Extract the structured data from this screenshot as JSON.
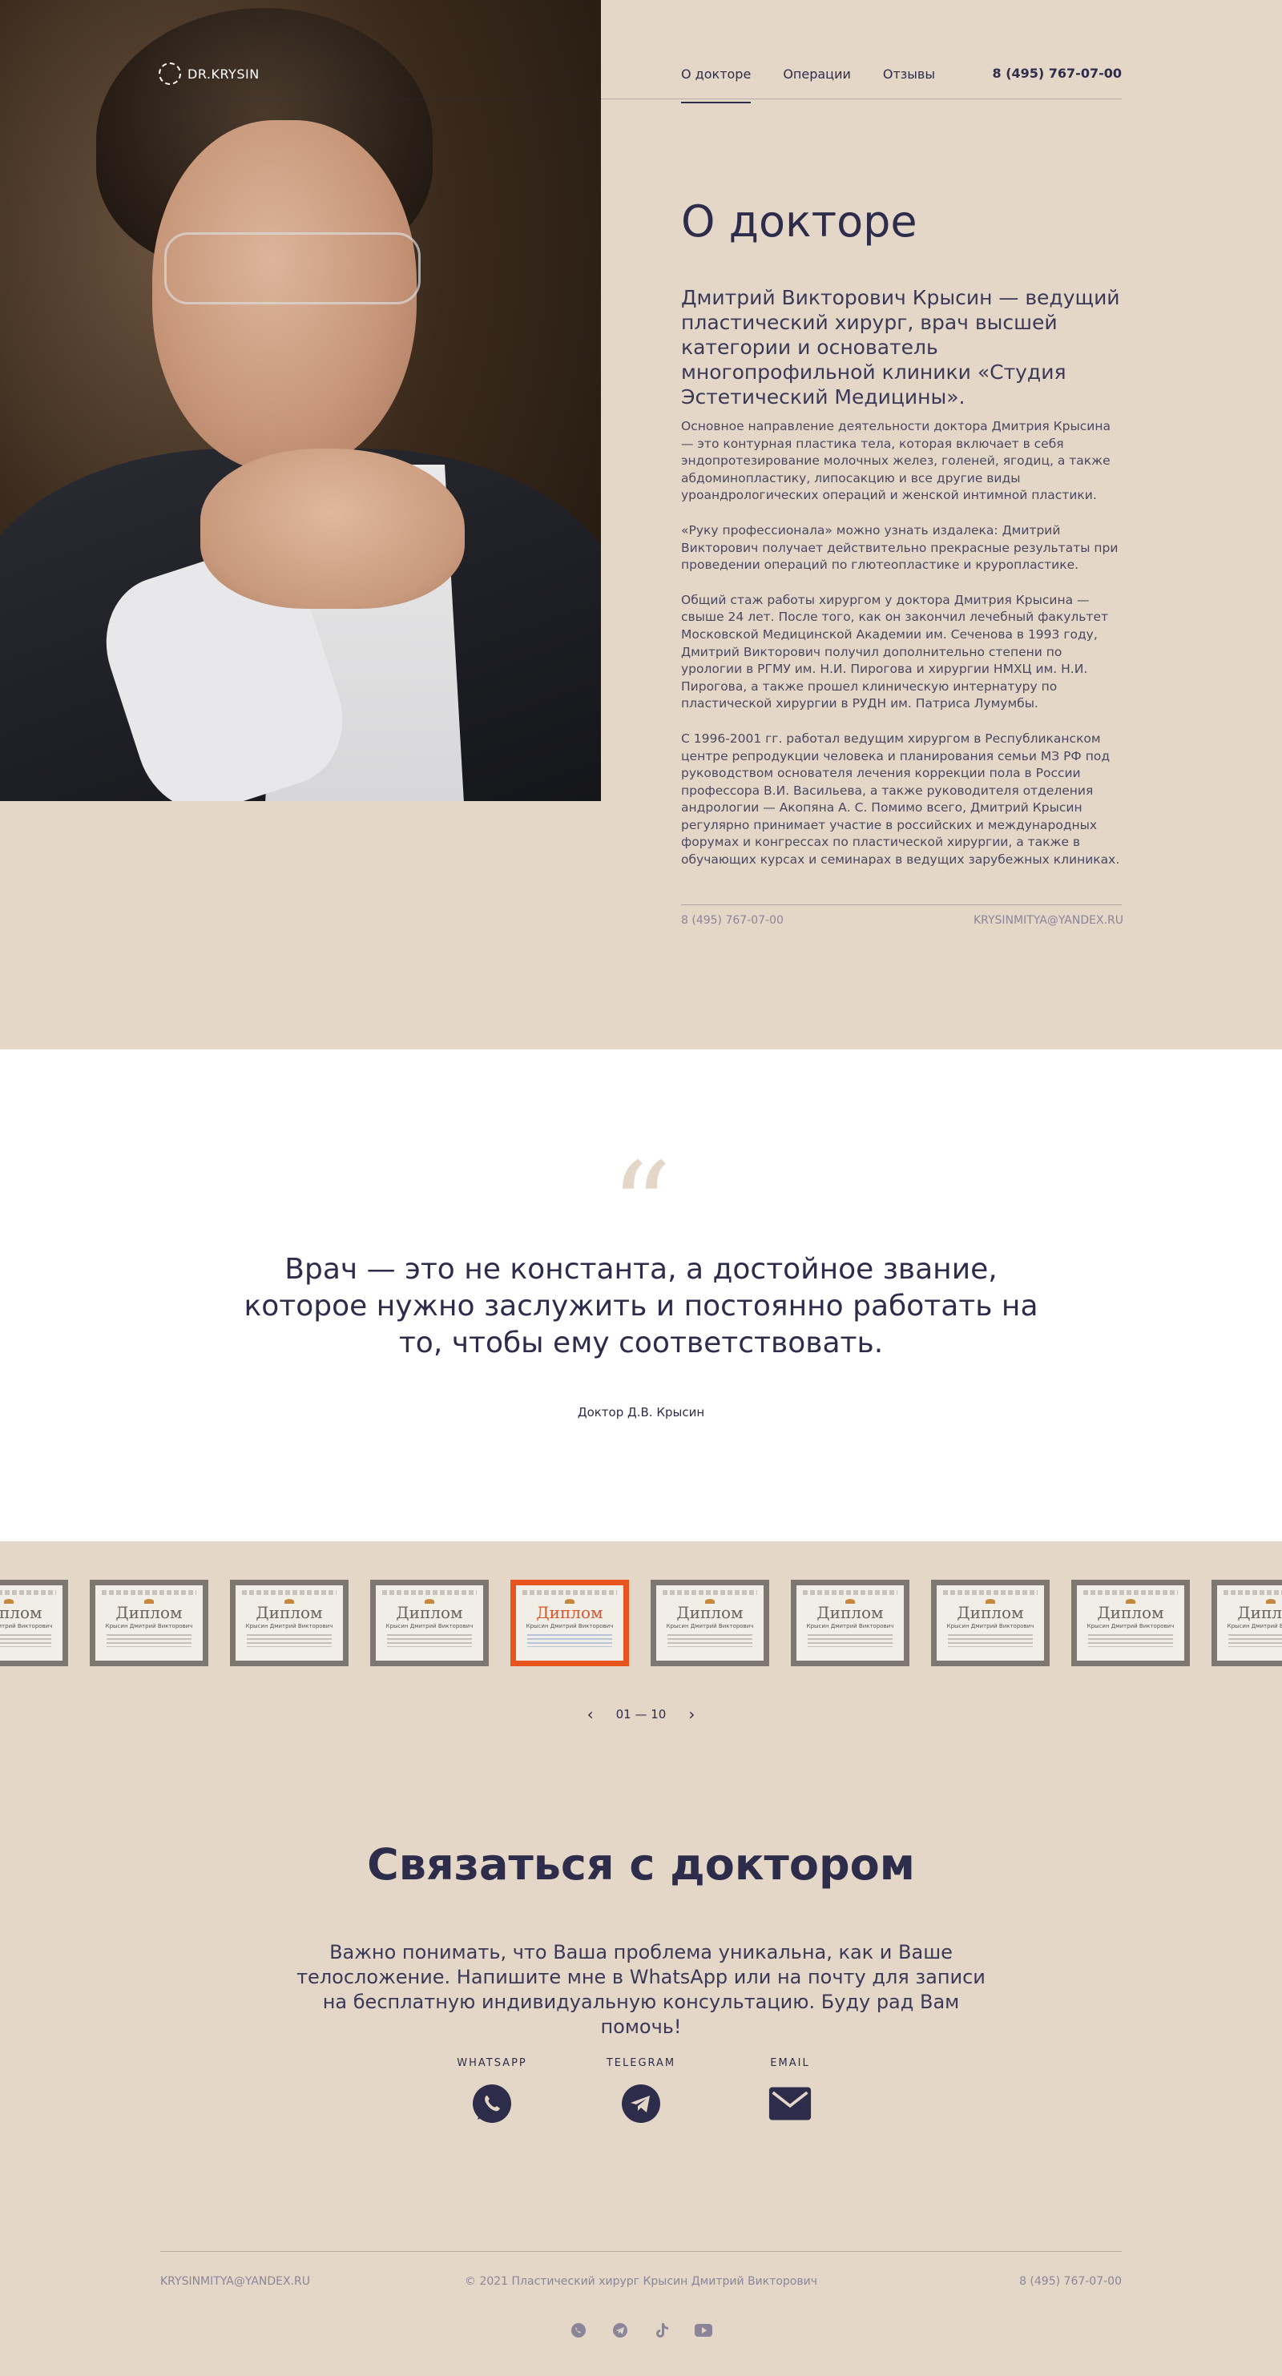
{
  "header": {
    "logo_text": "DR.KRYSIN",
    "nav": [
      {
        "label": "О докторе"
      },
      {
        "label": "Операции"
      },
      {
        "label": "Отзывы"
      }
    ],
    "phone": "8 (495) 767-07-00"
  },
  "about": {
    "title": "О докторе",
    "lead": "Дмитрий Викторович Крысин — ведущий пластический хирург, врач высшей категории и основатель многопрофильной клиники «Студия Эстетический Медицины».",
    "paragraphs": [
      "Основное направление деятельности доктора Дмитрия Крысина — это контурная пластика тела, которая включает в себя эндопротезирование молочных желез, голеней, ягодиц, а также абдоминопластику, липосакцию и все другие виды уроандрологических операций и женской интимной пластики.",
      "«Руку профессионала» можно узнать издалека: Дмитрий Викторович получает действительно прекрасные результаты при проведении операций по глютеопластике и круропластике.",
      "Общий стаж работы хирургом у доктора Дмитрия Крысина — свыше 24 лет. После того, как он закончил лечебный факультет Московской Медицинской Академии им. Сеченова в 1993 году, Дмитрий Викторович получил дополнительно степени по урологии в РГМУ им. Н.И. Пирогова и хирургии НМХЦ им. Н.И. Пирогова, а также прошел клиническую интернатуру по пластической хирургии в РУДН им. Патриса Лумумбы.",
      "С 1996-2001 гг. работал ведущим хирургом в Республиканском центре репродукции человека и планирования семьи МЗ РФ под руководством основателя лечения коррекции пола в России профессора В.И. Васильева, а также руководителя отделения андрологии — Акопяна А. С. Помимо всего, Дмитрий Крысин регулярно принимает участие в российских и международных форумах и конгрессах по пластической хирургии, а также в обучающих курсах и семинарах в ведущих зарубежных клиниках."
    ],
    "phone": "8 (495) 767-07-00",
    "email": "KRYSINMITYA@YANDEX.RU"
  },
  "quote": {
    "mark": "“",
    "text": "Врач — это не константа, а достойное звание, которое нужно заслужить и постоянно работать на то, чтобы ему соответствовать.",
    "author": "Доктор Д.В. Крысин"
  },
  "diplomas": {
    "title_word": "Диплом",
    "name": "Крысин Дмитрий Викторович",
    "active_index": 4,
    "pager": "01 — 10",
    "prev_icon": "chevron-left-icon",
    "next_icon": "chevron-right-icon"
  },
  "contact": {
    "title": "Связаться с доктором",
    "text": "Важно понимать, что Ваша проблема уникальна, как и Ваше телосложение. Напишите мне в WhatsApp или на почту для записи на бесплатную индивидуальную консультацию. Буду рад Вам помочь!",
    "channels": [
      {
        "label": "WHATSAPP",
        "icon": "whatsapp-icon"
      },
      {
        "label": "TELEGRAM",
        "icon": "telegram-icon"
      },
      {
        "label": "EMAIL",
        "icon": "mail-icon"
      }
    ]
  },
  "footer": {
    "email": "KRYSINMITYA@YANDEX.RU",
    "copyright": "© 2021 Пластический хирург Крысин Дмитрий Викторович",
    "phone": "8 (495) 767-07-00",
    "socials": [
      "whatsapp-icon",
      "telegram-icon",
      "tiktok-icon",
      "youtube-icon"
    ]
  },
  "colors": {
    "background": "#e4d7c7",
    "text": "#2e2c4b",
    "accent": "#e8541e"
  }
}
